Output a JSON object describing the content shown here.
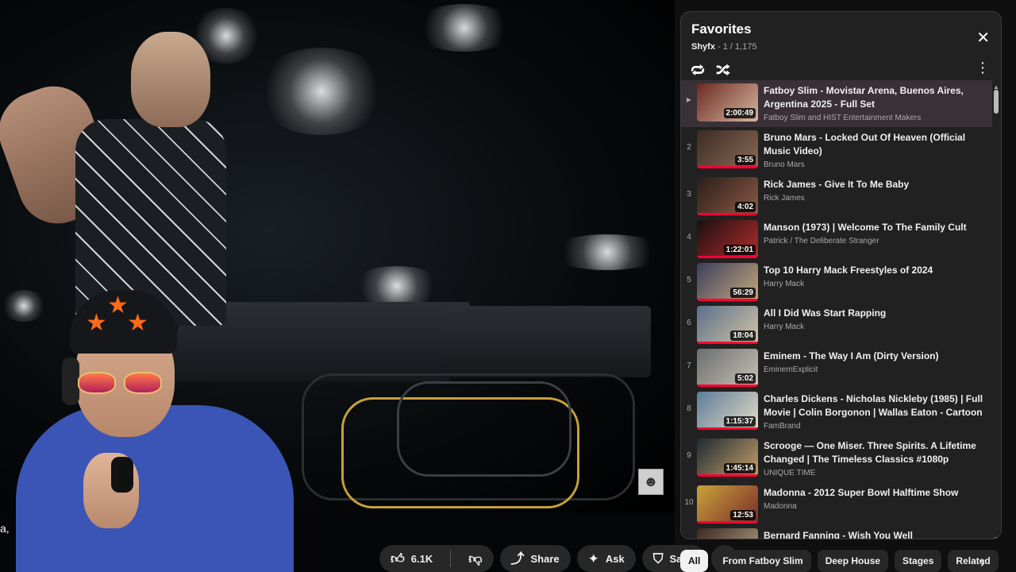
{
  "playlist": {
    "title": "Favorites",
    "owner": "Shyfx",
    "position": "1 / 1,175",
    "items": [
      {
        "index": "",
        "title": "Fatboy Slim - Movistar Arena, Buenos Aires, Argentina 2025 - Full Set",
        "channel": "Fatboy Slim and HIST Entertainment Makers",
        "duration": "2:00:49",
        "active": true
      },
      {
        "index": "2",
        "title": "Bruno Mars - Locked Out Of Heaven (Official Music Video)",
        "channel": "Bruno Mars",
        "duration": "3:55",
        "active": false
      },
      {
        "index": "3",
        "title": "Rick James - Give It To Me Baby",
        "channel": "Rick James",
        "duration": "4:02",
        "active": false
      },
      {
        "index": "4",
        "title": "Manson (1973) | Welcome To The Family Cult",
        "channel": "Patrick / The Deliberate Stranger",
        "duration": "1:22:01",
        "active": false
      },
      {
        "index": "5",
        "title": "Top 10 Harry Mack Freestyles of 2024",
        "channel": "Harry Mack",
        "duration": "56:29",
        "active": false
      },
      {
        "index": "6",
        "title": "All I Did Was Start Rapping",
        "channel": "Harry Mack",
        "duration": "18:04",
        "active": false
      },
      {
        "index": "7",
        "title": "Eminem - The Way I Am (Dirty Version)",
        "channel": "EminemExplicit",
        "duration": "5:02",
        "active": false
      },
      {
        "index": "8",
        "title": "Charles Dickens - Nicholas Nickleby (1985) | Full Movie | Colin Borgonon | Wallas Eaton - Cartoon",
        "channel": "FamBrand",
        "duration": "1:15:37",
        "active": false
      },
      {
        "index": "9",
        "title": "Scrooge — One Miser. Three Spirits. A Lifetime Changed | The Timeless Classics #1080p",
        "channel": "UNIQUE TIME",
        "duration": "1:45:14",
        "active": false
      },
      {
        "index": "10",
        "title": "Madonna - 2012 Super Bowl Halftime Show",
        "channel": "Madonna",
        "duration": "12:53",
        "active": false
      },
      {
        "index": "",
        "title": "Bernard Fanning - Wish You Well",
        "channel": "",
        "duration": "",
        "active": false
      }
    ]
  },
  "actions": {
    "like_count": "6.1K",
    "share_label": "Share",
    "ask_label": "Ask",
    "save_label": "Save"
  },
  "chips": [
    "All",
    "From Fatboy Slim",
    "Deep House",
    "Stages",
    "Related"
  ],
  "overlay_text": {
    "edge_text": "a,"
  },
  "colors": {
    "accent": "#ff0033",
    "panel_bg": "#212121",
    "page_bg": "#0f0f0f"
  }
}
